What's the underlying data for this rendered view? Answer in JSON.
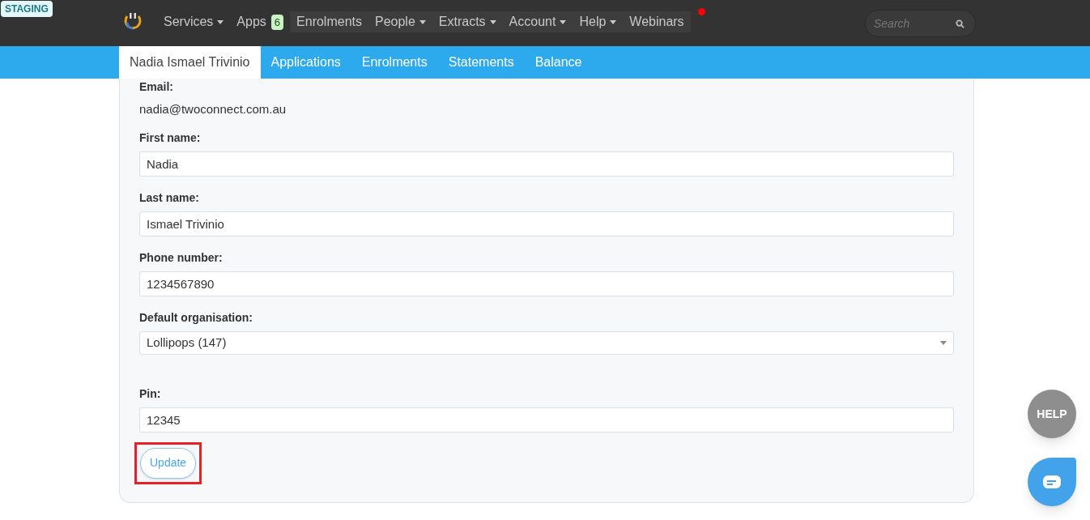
{
  "environment_badge": "STAGING",
  "nav": [
    {
      "label": "Services",
      "dropdown": true
    },
    {
      "label": "Apps",
      "badge": "6",
      "dropdown": false
    },
    {
      "label": "Enrolments",
      "dropdown": false
    },
    {
      "label": "People",
      "dropdown": true
    },
    {
      "label": "Extracts",
      "dropdown": true
    },
    {
      "label": "Account",
      "dropdown": true
    },
    {
      "label": "Help",
      "dropdown": true
    },
    {
      "label": "Webinars",
      "dropdown": false,
      "notification": true
    }
  ],
  "search": {
    "placeholder": "Search"
  },
  "tabs": [
    {
      "label": "Nadia Ismael Trivinio",
      "selected": true
    },
    {
      "label": "Applications",
      "selected": false
    },
    {
      "label": "Enrolments",
      "selected": false
    },
    {
      "label": "Statements",
      "selected": false
    },
    {
      "label": "Balance",
      "selected": false
    }
  ],
  "form": {
    "fields": [
      {
        "kind": "static",
        "label": "Email:",
        "value": "nadia@twoconnect.com.au"
      },
      {
        "kind": "text",
        "label": "First name:",
        "value": "Nadia"
      },
      {
        "kind": "text",
        "label": "Last name:",
        "value": "Ismael Trivinio"
      },
      {
        "kind": "text",
        "label": "Phone number:",
        "value": "1234567890"
      },
      {
        "kind": "select",
        "label": "Default organisation:",
        "value": "Lollipops (147)"
      },
      {
        "kind": "text",
        "label": "Pin:",
        "value": "12345",
        "gap_before": true
      }
    ],
    "submit": {
      "label": "Update",
      "annotated": true
    }
  },
  "help_button": "HELP"
}
